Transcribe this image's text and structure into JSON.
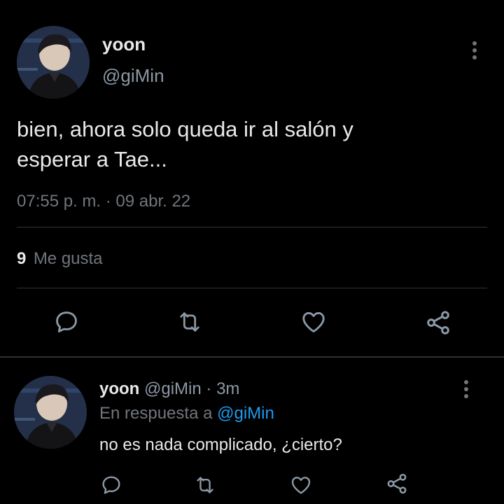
{
  "tweet": {
    "author_name": "yoon",
    "author_handle": "@giMin",
    "text_line1": "bien, ahora solo queda ir al salón y",
    "text_line2": "esperar a Tae...",
    "timestamp": "07:55 p. m. · 09 abr. 22",
    "likes_count": "9",
    "likes_label": "Me gusta"
  },
  "reply": {
    "author_name": "yoon",
    "author_handle": "@giMin",
    "time_sep": "·",
    "time": "3m",
    "reply_to_label": "En respuesta a",
    "reply_to_handle": "@giMin",
    "text": "no es nada complicado, ¿cierto?"
  },
  "icons": {
    "reply": "comment-icon",
    "retweet": "retweet-icon",
    "like": "heart-icon",
    "share": "share-icon",
    "more": "more-vertical-icon"
  },
  "colors": {
    "background": "#000000",
    "text": "#e7e9ea",
    "muted": "#71767b",
    "link": "#1d9bf0",
    "divider": "#2f3336"
  }
}
